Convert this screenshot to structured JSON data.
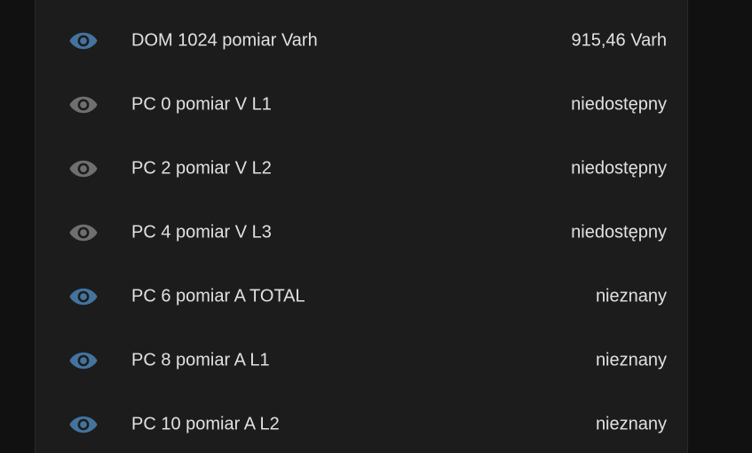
{
  "entities": [
    {
      "name": "DOM 1024 pomiar Varh",
      "state": "915,46 Varh",
      "icon": "eye-icon",
      "icon_color": "#44739e",
      "available": true
    },
    {
      "name": "PC 0 pomiar V L1",
      "state": "niedostępny",
      "icon": "eye-icon",
      "icon_color": "#6f6f6f",
      "available": false
    },
    {
      "name": "PC 2 pomiar V L2",
      "state": "niedostępny",
      "icon": "eye-icon",
      "icon_color": "#6f6f6f",
      "available": false
    },
    {
      "name": "PC 4 pomiar V L3",
      "state": "niedostępny",
      "icon": "eye-icon",
      "icon_color": "#6f6f6f",
      "available": false
    },
    {
      "name": "PC 6 pomiar A TOTAL",
      "state": "nieznany",
      "icon": "eye-icon",
      "icon_color": "#44739e",
      "available": true
    },
    {
      "name": "PC 8 pomiar A L1",
      "state": "nieznany",
      "icon": "eye-icon",
      "icon_color": "#44739e",
      "available": true
    },
    {
      "name": "PC 10 pomiar A L2",
      "state": "nieznany",
      "icon": "eye-icon",
      "icon_color": "#44739e",
      "available": true
    }
  ],
  "colors": {
    "background": "#111111",
    "card": "#1c1c1c",
    "text": "#e1e1e1",
    "icon_active": "#44739e",
    "icon_unavailable": "#6f6f6f"
  }
}
